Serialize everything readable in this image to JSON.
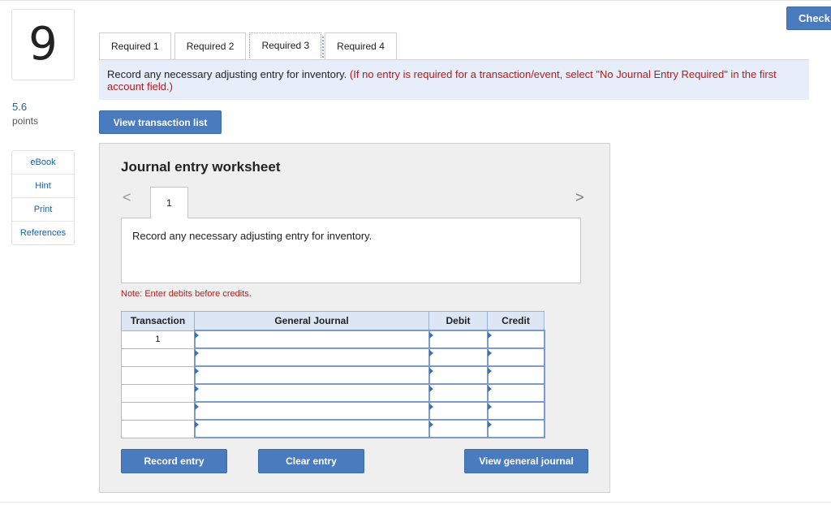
{
  "question": {
    "number": "9",
    "points_value": "5.6",
    "points_label": "points"
  },
  "tools": [
    "eBook",
    "Hint",
    "Print",
    "References"
  ],
  "check_label": "Check",
  "tabs": [
    "Required 1",
    "Required 2",
    "Required 3",
    "Required 4"
  ],
  "active_tab_index": 2,
  "instructions": {
    "main": "Record any necessary adjusting entry for inventory.",
    "hint": "(If no entry is required for a transaction/event, select \"No Journal Entry Required\" in the first account field.)"
  },
  "view_transaction_list_label": "View transaction list",
  "worksheet": {
    "title": "Journal entry worksheet",
    "prev_icon": "<",
    "next_icon": ">",
    "entry_tab_label": "1",
    "entry_description": "Record any necessary adjusting entry for inventory.",
    "note": "Note: Enter debits before credits.",
    "columns": [
      "Transaction",
      "General Journal",
      "Debit",
      "Credit"
    ],
    "rows": [
      {
        "transaction": "1",
        "account": "",
        "debit": "",
        "credit": ""
      },
      {
        "transaction": "",
        "account": "",
        "debit": "",
        "credit": ""
      },
      {
        "transaction": "",
        "account": "",
        "debit": "",
        "credit": ""
      },
      {
        "transaction": "",
        "account": "",
        "debit": "",
        "credit": ""
      },
      {
        "transaction": "",
        "account": "",
        "debit": "",
        "credit": ""
      },
      {
        "transaction": "",
        "account": "",
        "debit": "",
        "credit": ""
      }
    ],
    "record_entry_label": "Record entry",
    "clear_entry_label": "Clear entry",
    "view_general_journal_label": "View general journal"
  },
  "colors": {
    "accent": "#4a7bbf",
    "link": "#1a5fa8",
    "alert_red": "#b31b1b",
    "panel_bg": "#e7eefa",
    "header_bg": "#dde6f4"
  }
}
